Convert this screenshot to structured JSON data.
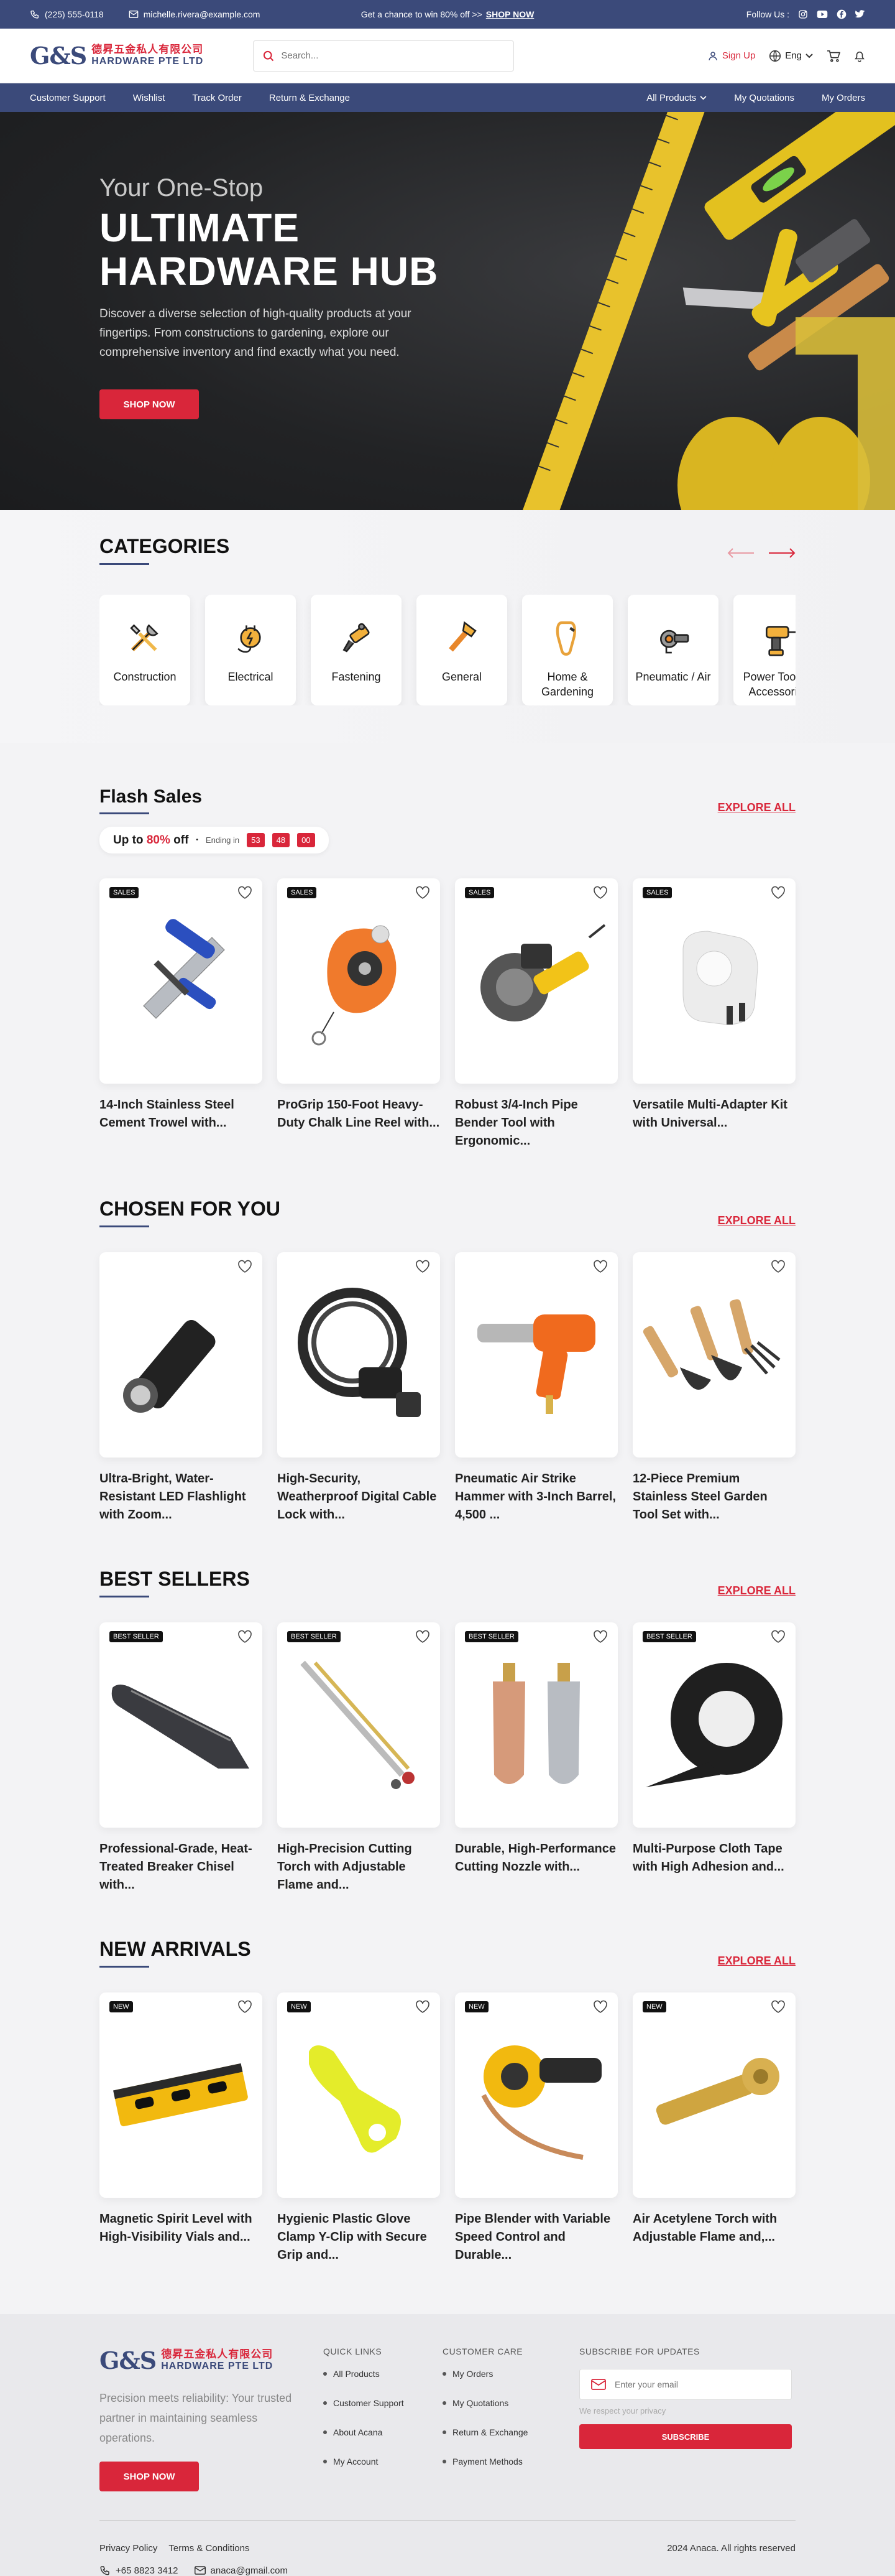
{
  "topbar": {
    "phone": "(225) 555-0118",
    "email": "michelle.rivera@example.com",
    "promo": "Get a chance to win 80% off >>",
    "promo_link": "SHOP NOW",
    "follow": "Follow Us :"
  },
  "header": {
    "logo_mark": "G&S",
    "logo_zh": "德昇五金私人有限公司",
    "logo_en": "HARDWARE PTE LTD",
    "search_placeholder": "Search...",
    "signup": "Sign Up",
    "lang": "Eng"
  },
  "nav": {
    "left": [
      "Customer Support",
      "Wishlist",
      "Track Order",
      "Return & Exchange"
    ],
    "all_products": "All Products",
    "quotations": "My Quotations",
    "orders": "My Orders"
  },
  "hero": {
    "pre": "Your One-Stop",
    "title": "ULTIMATE HARDWARE HUB",
    "desc": "Discover a diverse selection of high-quality products at your fingertips. From constructions to gardening, explore our comprehensive inventory and find exactly what you need.",
    "cta": "SHOP NOW"
  },
  "categories": {
    "title": "CATEGORIES",
    "items": [
      {
        "label": "Construction",
        "icon": "construction-icon"
      },
      {
        "label": "Electrical",
        "icon": "electrical-icon"
      },
      {
        "label": "Fastening",
        "icon": "fastening-icon"
      },
      {
        "label": "General",
        "icon": "general-icon"
      },
      {
        "label": "Home & Gardening",
        "icon": "home-gardening-icon"
      },
      {
        "label": "Pneumatic / Air",
        "icon": "pneumatic-icon"
      },
      {
        "label": "Power Tools & Accessories",
        "icon": "power-tools-icon"
      }
    ]
  },
  "flash": {
    "title": "Flash Sales",
    "explore": "EXPLORE ALL",
    "up_to": "Up to",
    "percent": "80%",
    "off": "off",
    "ending": "Ending in",
    "timer": [
      "53",
      "48",
      "00"
    ],
    "badge": "SALES",
    "products": [
      "14-Inch Stainless Steel Cement Trowel with...",
      "ProGrip 150-Foot Heavy-Duty Chalk Line Reel with...",
      "Robust 3/4-Inch Pipe Bender Tool with Ergonomic...",
      "Versatile Multi-Adapter Kit with Universal..."
    ]
  },
  "chosen": {
    "title": "CHOSEN FOR YOU",
    "explore": "EXPLORE ALL",
    "products": [
      "Ultra-Bright, Water-Resistant LED Flashlight with Zoom...",
      "High-Security, Weatherproof Digital Cable Lock with...",
      "Pneumatic Air Strike Hammer with 3-Inch Barrel, 4,500 ...",
      "12-Piece Premium Stainless Steel Garden Tool Set with..."
    ]
  },
  "best": {
    "title": "BEST SELLERS",
    "explore": "EXPLORE ALL",
    "badge": "BEST SELLER",
    "products": [
      "Professional-Grade, Heat-Treated Breaker Chisel with...",
      "High-Precision Cutting Torch with Adjustable Flame and...",
      "Durable, High-Performance Cutting Nozzle with...",
      "Multi-Purpose Cloth Tape with High Adhesion and..."
    ]
  },
  "arrivals": {
    "title": "NEW ARRIVALS",
    "explore": "EXPLORE ALL",
    "badge": "NEW",
    "products": [
      "Magnetic Spirit Level with High-Visibility Vials and...",
      "Hygienic Plastic Glove Clamp Y-Clip with Secure Grip and...",
      "Pipe Blender with Variable Speed Control and Durable...",
      "Air Acetylene Torch with Adjustable Flame and,..."
    ]
  },
  "footer": {
    "tagline": "Precision meets reliability: Your trusted partner in maintaining seamless operations.",
    "cta": "SHOP NOW",
    "quick_title": "QUICK LINKS",
    "quick": [
      "All Products",
      "Customer Support",
      "About Acana",
      "My Account"
    ],
    "care_title": "CUSTOMER CARE",
    "care": [
      "My Orders",
      "My Quotations",
      "Return & Exchange",
      "Payment Methods"
    ],
    "sub_title": "SUBSCRIBE FOR UPDATES",
    "email_placeholder": "Enter your email",
    "privacy_note": "We respect your privacy",
    "subscribe": "SUBSCRIBE",
    "policy": "Privacy Policy",
    "terms": "Terms & Conditions",
    "phone": "+65 8823 3412",
    "email": "anaca@gmail.com",
    "copyright": "2024 Anaca. All rights reserved"
  },
  "colors": {
    "navy": "#3b4a7a",
    "red": "#d9263a"
  }
}
